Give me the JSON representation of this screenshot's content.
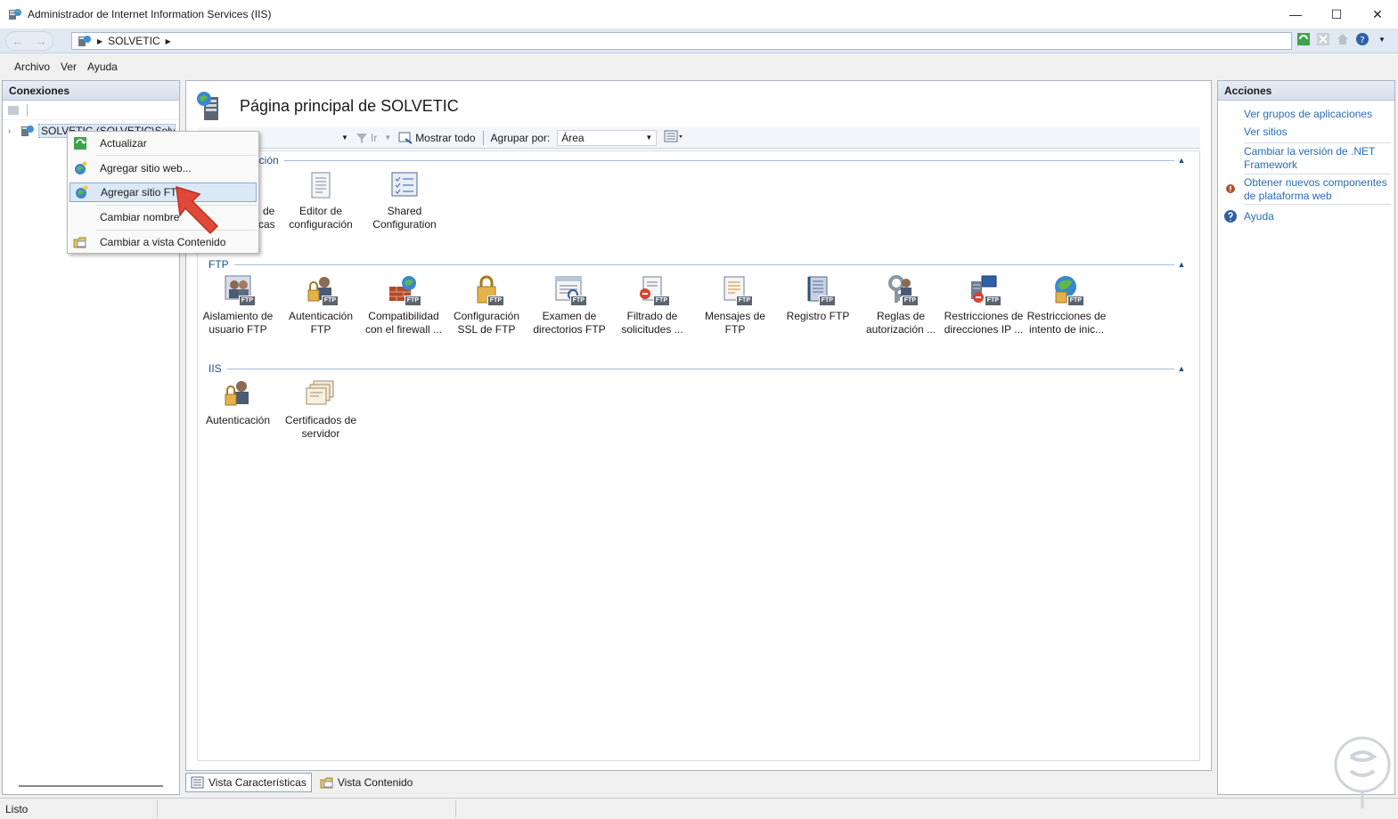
{
  "window": {
    "title": "Administrador de Internet Information Services (IIS)",
    "controls": {
      "minimize": "—",
      "maximize": "☐",
      "close": "✕"
    }
  },
  "address": {
    "segment": "SOLVETIC",
    "nav_back": "←",
    "nav_forward": "→",
    "help": "?"
  },
  "menu": {
    "items": [
      "Archivo",
      "Ver",
      "Ayuda"
    ]
  },
  "connections": {
    "header": "Conexiones",
    "tree_root": "SOLVETIC (SOLVETIC\\Solvetic)"
  },
  "main": {
    "title": "Página principal de SOLVETIC",
    "filter": {
      "go_label": "Ir",
      "show_all": "Mostrar todo",
      "group_by_label": "Agrupar por:",
      "group_by_value": "Área"
    },
    "groups": [
      {
        "name": "Administración",
        "features": [
          {
            "label": "Delegación de características",
            "icon": "feature-delegation-icon"
          },
          {
            "label": "Editor de configuración",
            "icon": "config-editor-icon"
          },
          {
            "label": "Shared Configuration",
            "icon": "shared-config-icon"
          }
        ]
      },
      {
        "name": "FTP",
        "features": [
          {
            "label": "Aislamiento de usuario FTP",
            "icon": "ftp-user-isolation-icon"
          },
          {
            "label": "Autenticación FTP",
            "icon": "ftp-auth-icon"
          },
          {
            "label": "Compatibilidad con el firewall ...",
            "icon": "ftp-firewall-icon"
          },
          {
            "label": "Configuración SSL de FTP",
            "icon": "ftp-ssl-icon"
          },
          {
            "label": "Examen de directorios FTP",
            "icon": "ftp-dir-browse-icon"
          },
          {
            "label": "Filtrado de solicitudes ...",
            "icon": "ftp-request-filter-icon"
          },
          {
            "label": "Mensajes de FTP",
            "icon": "ftp-messages-icon"
          },
          {
            "label": "Registro FTP",
            "icon": "ftp-logging-icon"
          },
          {
            "label": "Reglas de autorización ...",
            "icon": "ftp-authz-rules-icon"
          },
          {
            "label": "Restricciones de direcciones IP ...",
            "icon": "ftp-ip-restrict-icon"
          },
          {
            "label": "Restricciones de intento de inic...",
            "icon": "ftp-logon-attempt-icon"
          }
        ]
      },
      {
        "name": "IIS",
        "features": [
          {
            "label": "Autenticación",
            "icon": "auth-icon"
          },
          {
            "label": "Certificados de servidor",
            "icon": "server-certs-icon"
          }
        ]
      }
    ],
    "ftp_badge": "FTP",
    "tabs": [
      "Vista Características",
      "Vista Contenido"
    ]
  },
  "actions": {
    "header": "Acciones",
    "links": [
      "Ver grupos de aplicaciones",
      "Ver sitios",
      "Cambiar la versión de .NET Framework",
      "Obtener nuevos componentes de plataforma web",
      "Ayuda"
    ]
  },
  "context_menu": {
    "items": [
      {
        "label": "Actualizar",
        "icon": "refresh-icon"
      },
      {
        "label": "Agregar sitio web...",
        "icon": "add-website-icon"
      },
      {
        "label": "Agregar sitio FTP...",
        "icon": "add-ftp-site-icon",
        "highlighted": true
      },
      {
        "label": "Cambiar nombre",
        "icon": ""
      },
      {
        "label": "Cambiar a vista Contenido",
        "icon": "content-view-icon"
      }
    ]
  },
  "status": {
    "text": "Listo"
  },
  "colors": {
    "accent_link": "#2a6cb5",
    "group_header": "#1e4f8a",
    "pointer": "#e0483a"
  }
}
